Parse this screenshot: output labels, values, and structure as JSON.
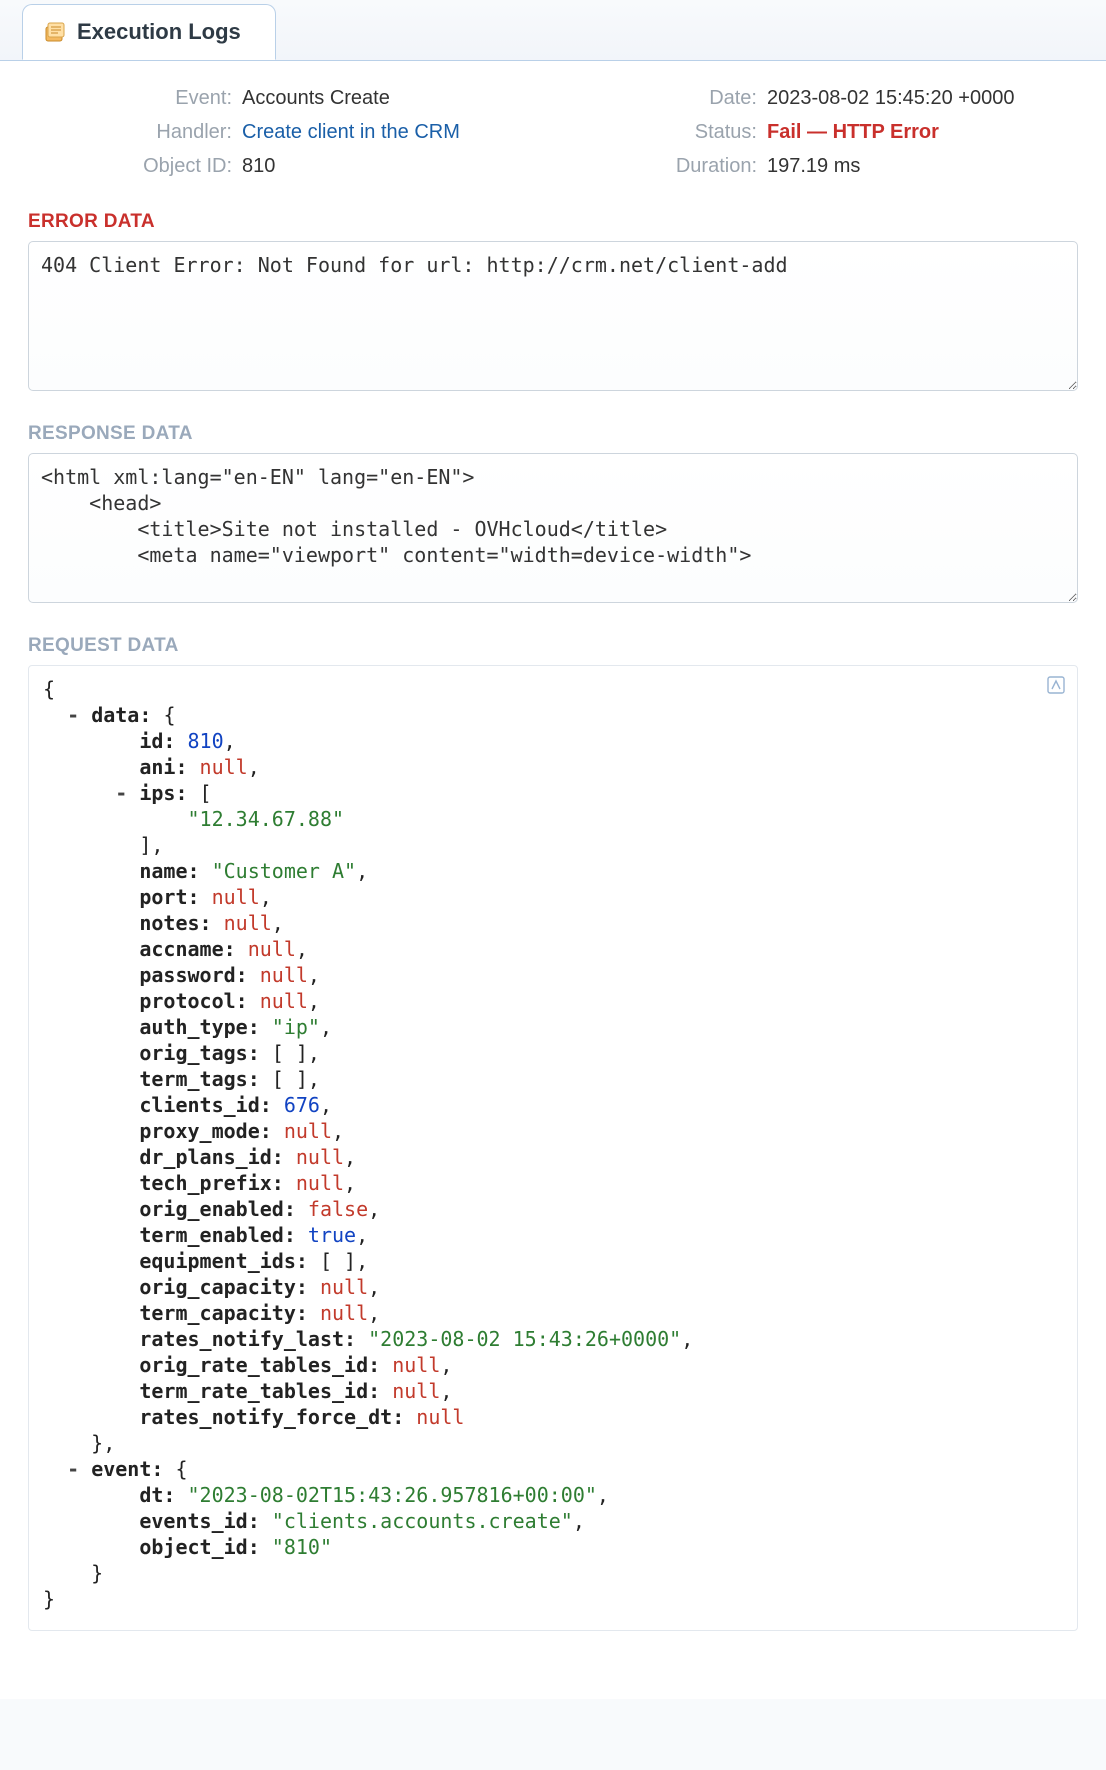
{
  "tab": {
    "title": "Execution Logs"
  },
  "meta": {
    "left": {
      "event": {
        "label": "Event:",
        "value": "Accounts Create"
      },
      "handler": {
        "label": "Handler:",
        "value": "Create client in the CRM"
      },
      "object_id": {
        "label": "Object ID:",
        "value": "810"
      }
    },
    "right": {
      "date": {
        "label": "Date:",
        "value": "2023-08-02 15:45:20 +0000"
      },
      "status": {
        "label": "Status:",
        "value": "Fail — HTTP Error"
      },
      "duration": {
        "label": "Duration:",
        "value": "197.19 ms"
      }
    }
  },
  "error_data": {
    "heading": "ERROR DATA",
    "text": "404 Client Error: Not Found for url: http://crm.net/client-add"
  },
  "response_data": {
    "heading": "RESPONSE DATA",
    "text": "<html xml:lang=\"en-EN\" lang=\"en-EN\">\n    <head>\n        <title>Site not installed - OVHcloud</title>\n        <meta name=\"viewport\" content=\"width=device-width\">"
  },
  "request_data": {
    "heading": "REQUEST DATA",
    "data": {
      "id": 810,
      "ani": null,
      "ips": [
        "12.34.67.88"
      ],
      "name": "Customer A",
      "port": null,
      "notes": null,
      "accname": null,
      "password": null,
      "protocol": null,
      "auth_type": "ip",
      "orig_tags": [],
      "term_tags": [],
      "clients_id": 676,
      "proxy_mode": null,
      "dr_plans_id": null,
      "tech_prefix": null,
      "orig_enabled": false,
      "term_enabled": true,
      "equipment_ids": [],
      "orig_capacity": null,
      "term_capacity": null,
      "rates_notify_last": "2023-08-02 15:43:26+0000",
      "orig_rate_tables_id": null,
      "term_rate_tables_id": null,
      "rates_notify_force_dt": null
    },
    "event": {
      "dt": "2023-08-02T15:43:26.957816+00:00",
      "events_id": "clients.accounts.create",
      "object_id": "810"
    }
  }
}
